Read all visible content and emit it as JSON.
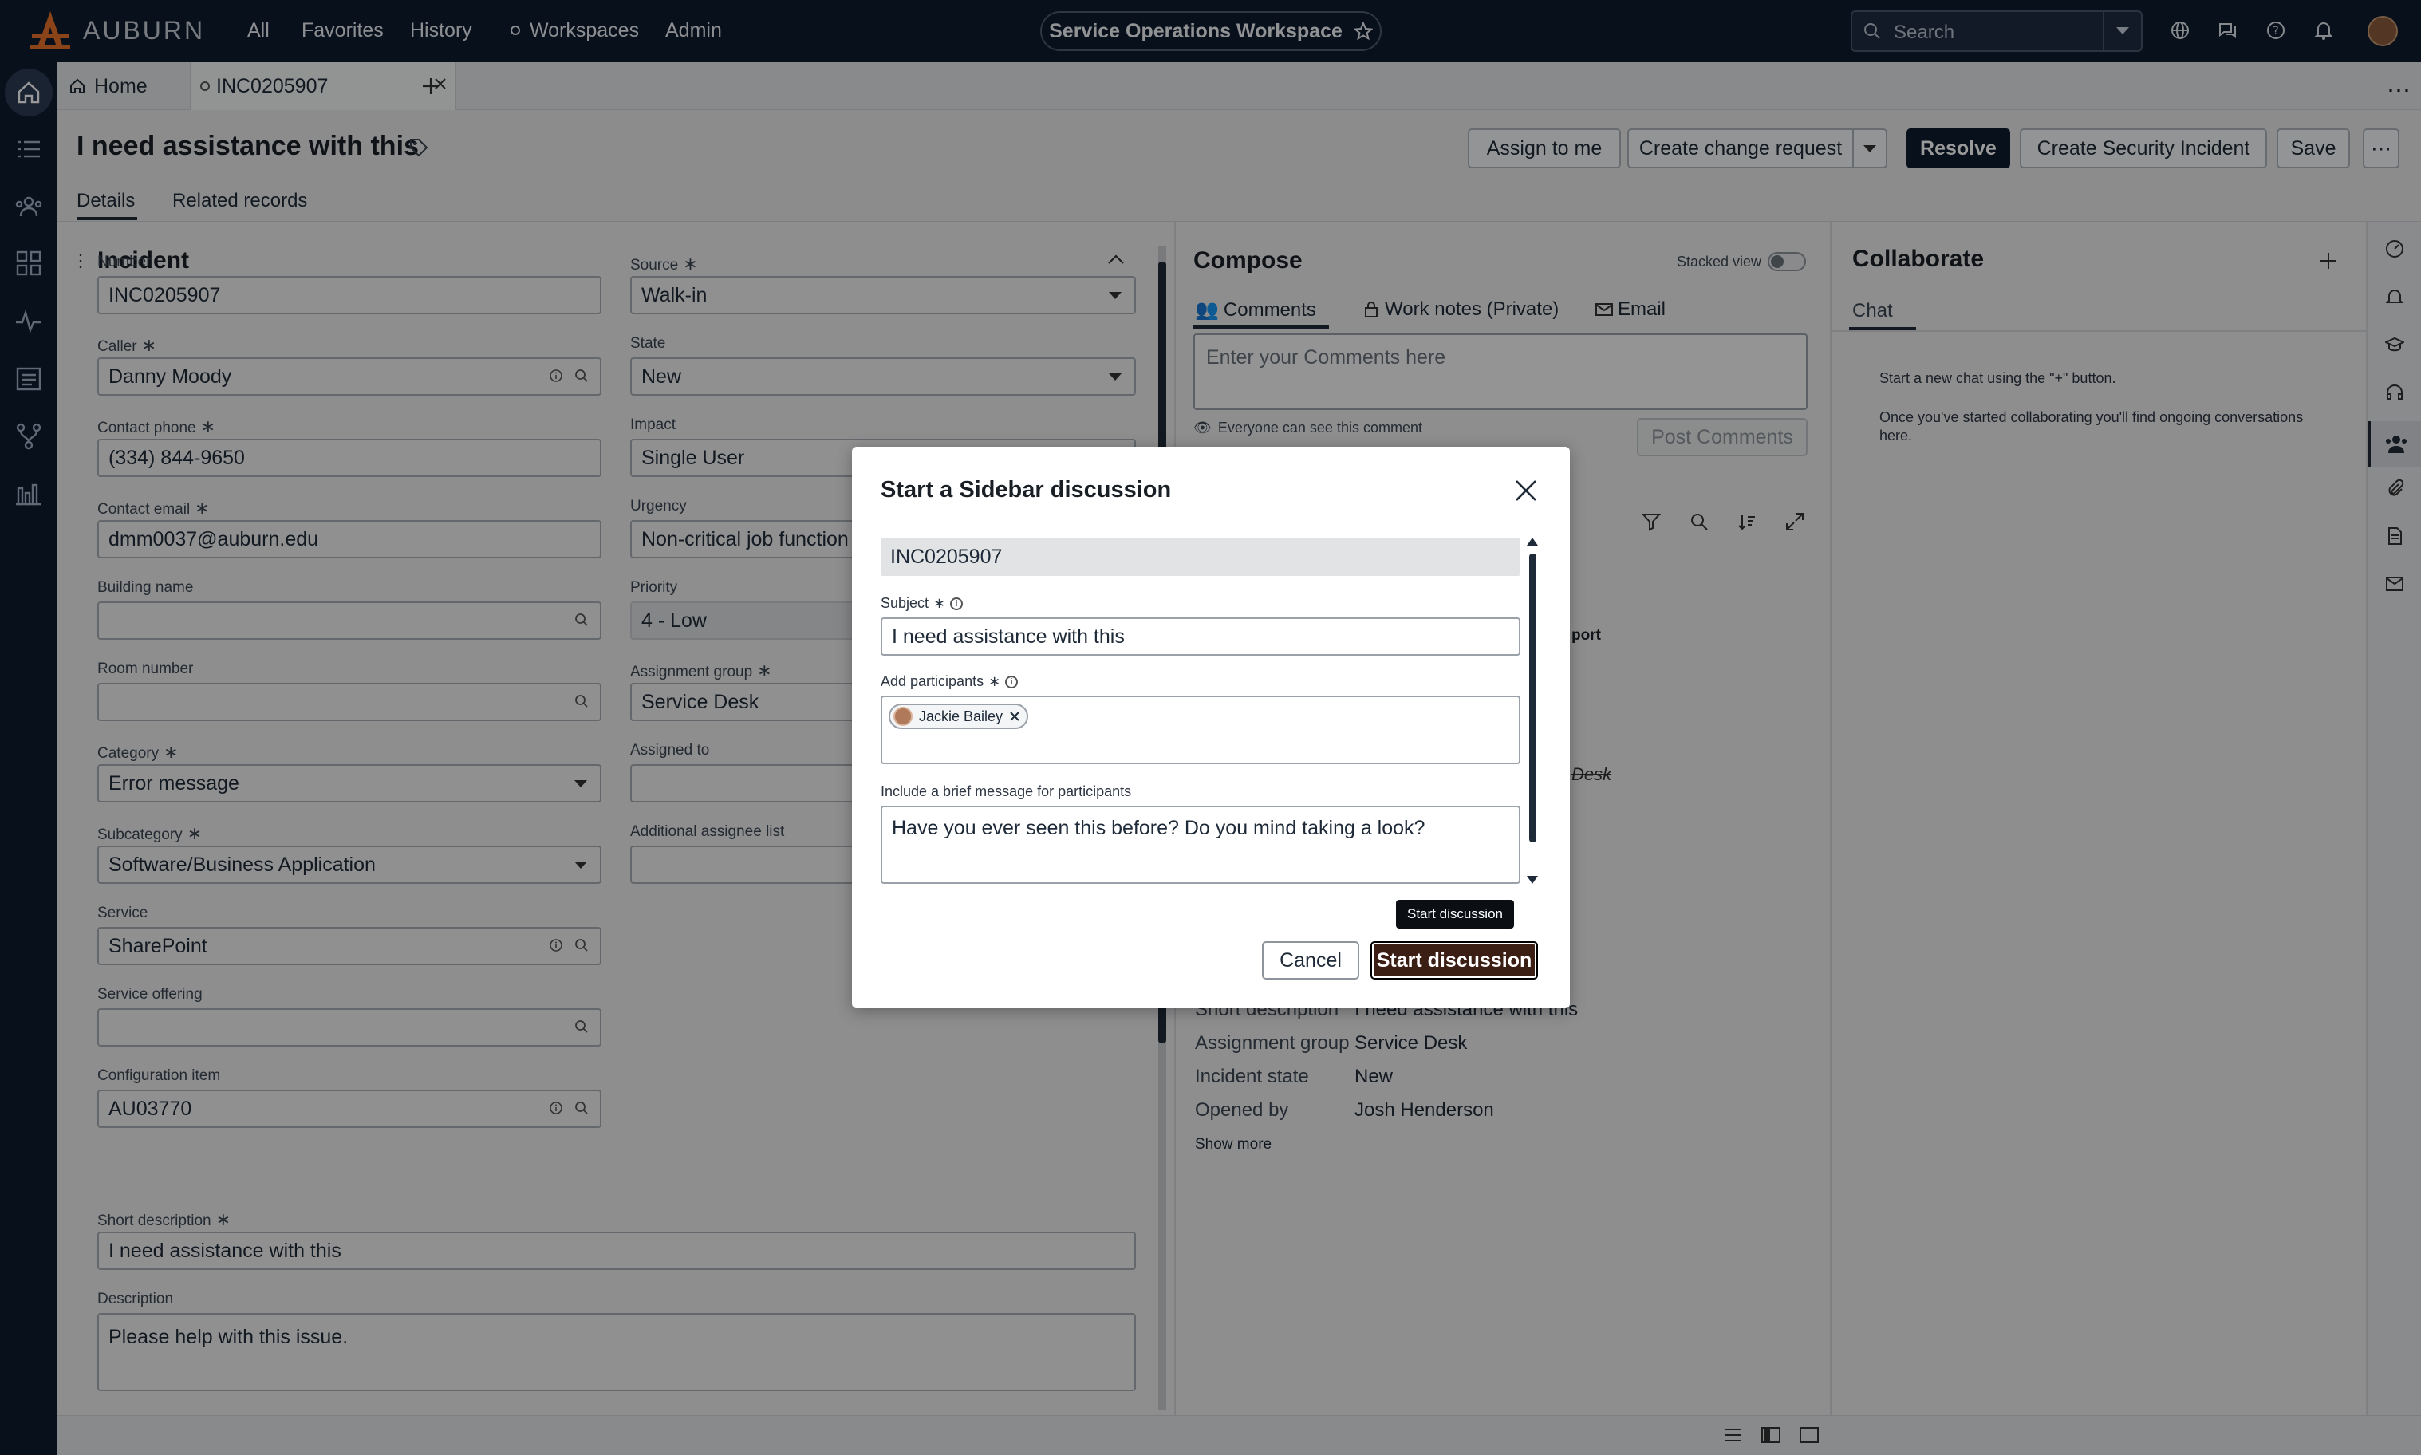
{
  "topnav": {
    "brand": "AUBURN",
    "links": [
      "All",
      "Favorites",
      "History",
      "Workspaces",
      "Admin"
    ],
    "workspace_title": "Service Operations Workspace",
    "search_placeholder": "Search"
  },
  "tabs": {
    "home": "Home",
    "record": "INC0205907"
  },
  "record": {
    "title": "I need assistance with this",
    "subtabs": [
      "Details",
      "Related records"
    ],
    "buttons": {
      "assign": "Assign to me",
      "change": "Create change request",
      "resolve": "Resolve",
      "security": "Create Security Incident",
      "save": "Save"
    }
  },
  "incident": {
    "heading": "Incident",
    "left": [
      {
        "label": "Number",
        "value": "INC0205907",
        "req": false
      },
      {
        "label": "Caller",
        "value": "Danny Moody",
        "req": true
      },
      {
        "label": "Contact phone",
        "value": "(334) 844-9650",
        "req": true
      },
      {
        "label": "Contact email",
        "value": "dmm0037@auburn.edu",
        "req": true
      },
      {
        "label": "Building name",
        "value": "",
        "req": false
      },
      {
        "label": "Room number",
        "value": "",
        "req": false
      },
      {
        "label": "Category",
        "value": "Error message",
        "req": true
      },
      {
        "label": "Subcategory",
        "value": "Software/Business Application",
        "req": true
      },
      {
        "label": "Service",
        "value": "SharePoint",
        "req": false
      },
      {
        "label": "Service offering",
        "value": "",
        "req": false
      },
      {
        "label": "Configuration item",
        "value": "AU03770",
        "req": false
      }
    ],
    "right": [
      {
        "label": "Source",
        "value": "Walk-in",
        "req": true
      },
      {
        "label": "State",
        "value": "New",
        "req": false
      },
      {
        "label": "Impact",
        "value": "Single User",
        "req": false
      },
      {
        "label": "Urgency",
        "value": "Non-critical job function a",
        "req": false
      },
      {
        "label": "Priority",
        "value": "4 - Low",
        "req": false
      },
      {
        "label": "Assignment group",
        "value": "Service Desk",
        "req": true
      },
      {
        "label": "Assigned to",
        "value": "",
        "req": false
      },
      {
        "label": "Additional assignee list",
        "value": "",
        "req": false
      }
    ],
    "short_desc_label": "Short description",
    "short_desc": "I need assistance with this",
    "desc_label": "Description",
    "desc": "Please help with this issue."
  },
  "compose": {
    "heading": "Compose",
    "stacked": "Stacked view",
    "tabs": [
      "Comments",
      "Work notes (Private)",
      "Email"
    ],
    "placeholder": "Enter your Comments here",
    "visibility": "Everyone can see this comment",
    "post": "Post Comments",
    "peek_report": "port",
    "peek_desk": "Desk",
    "details": [
      {
        "k": "Short description",
        "v": "I need assistance with this"
      },
      {
        "k": "Assignment group",
        "v": "Service Desk"
      },
      {
        "k": "Incident state",
        "v": "New"
      },
      {
        "k": "Opened by",
        "v": "Josh Henderson"
      }
    ],
    "show_more": "Show more"
  },
  "collab": {
    "heading": "Collaborate",
    "tab": "Chat",
    "line1": "Start a new chat using the \"+\" button.",
    "line2": "Once you've started collaborating you'll find ongoing conversations here."
  },
  "modal": {
    "title": "Start a Sidebar discussion",
    "record": "INC0205907",
    "subject_label": "Subject",
    "subject": "I need assistance with this",
    "participants_label": "Add participants",
    "participant": "Jackie Bailey",
    "message_label": "Include a brief message for participants",
    "message": "Have you ever seen this before? Do you mind taking a look?",
    "tooltip": "Start discussion",
    "cancel": "Cancel",
    "start": "Start discussion"
  }
}
